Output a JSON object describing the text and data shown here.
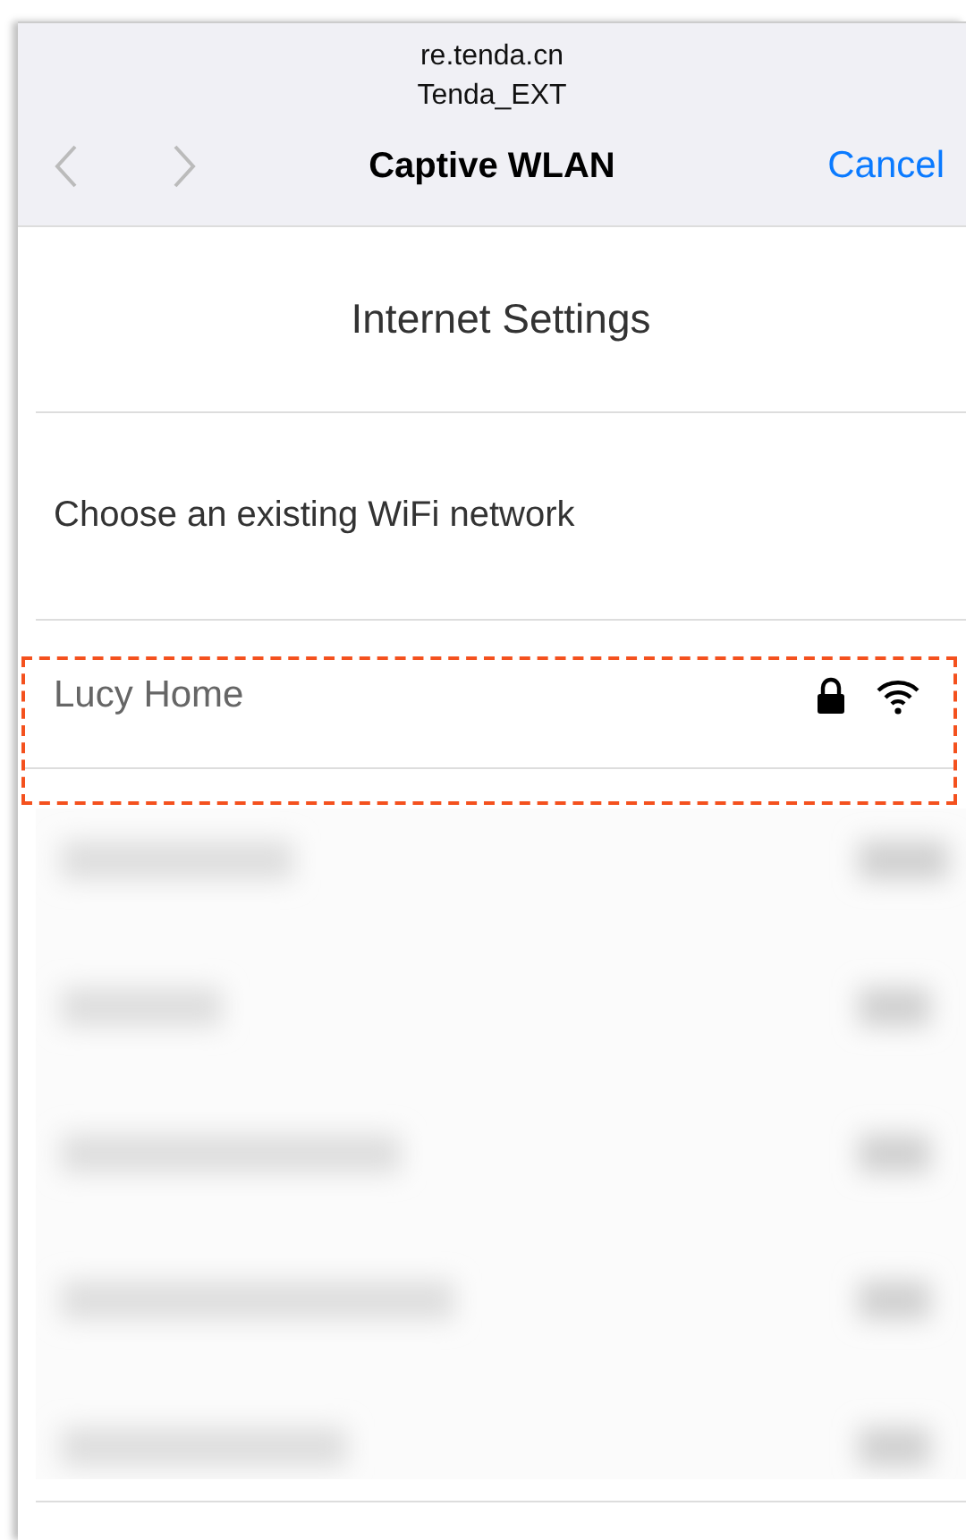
{
  "header": {
    "url": "re.tenda.cn",
    "network_name": "Tenda_EXT",
    "back_enabled": false,
    "forward_enabled": false,
    "title": "Captive WLAN",
    "cancel": "Cancel"
  },
  "page": {
    "title": "Internet Settings",
    "prompt": "Choose an existing WiFi network"
  },
  "networks": [
    {
      "name": "Lucy Home",
      "secured": true,
      "highlighted": true
    }
  ]
}
